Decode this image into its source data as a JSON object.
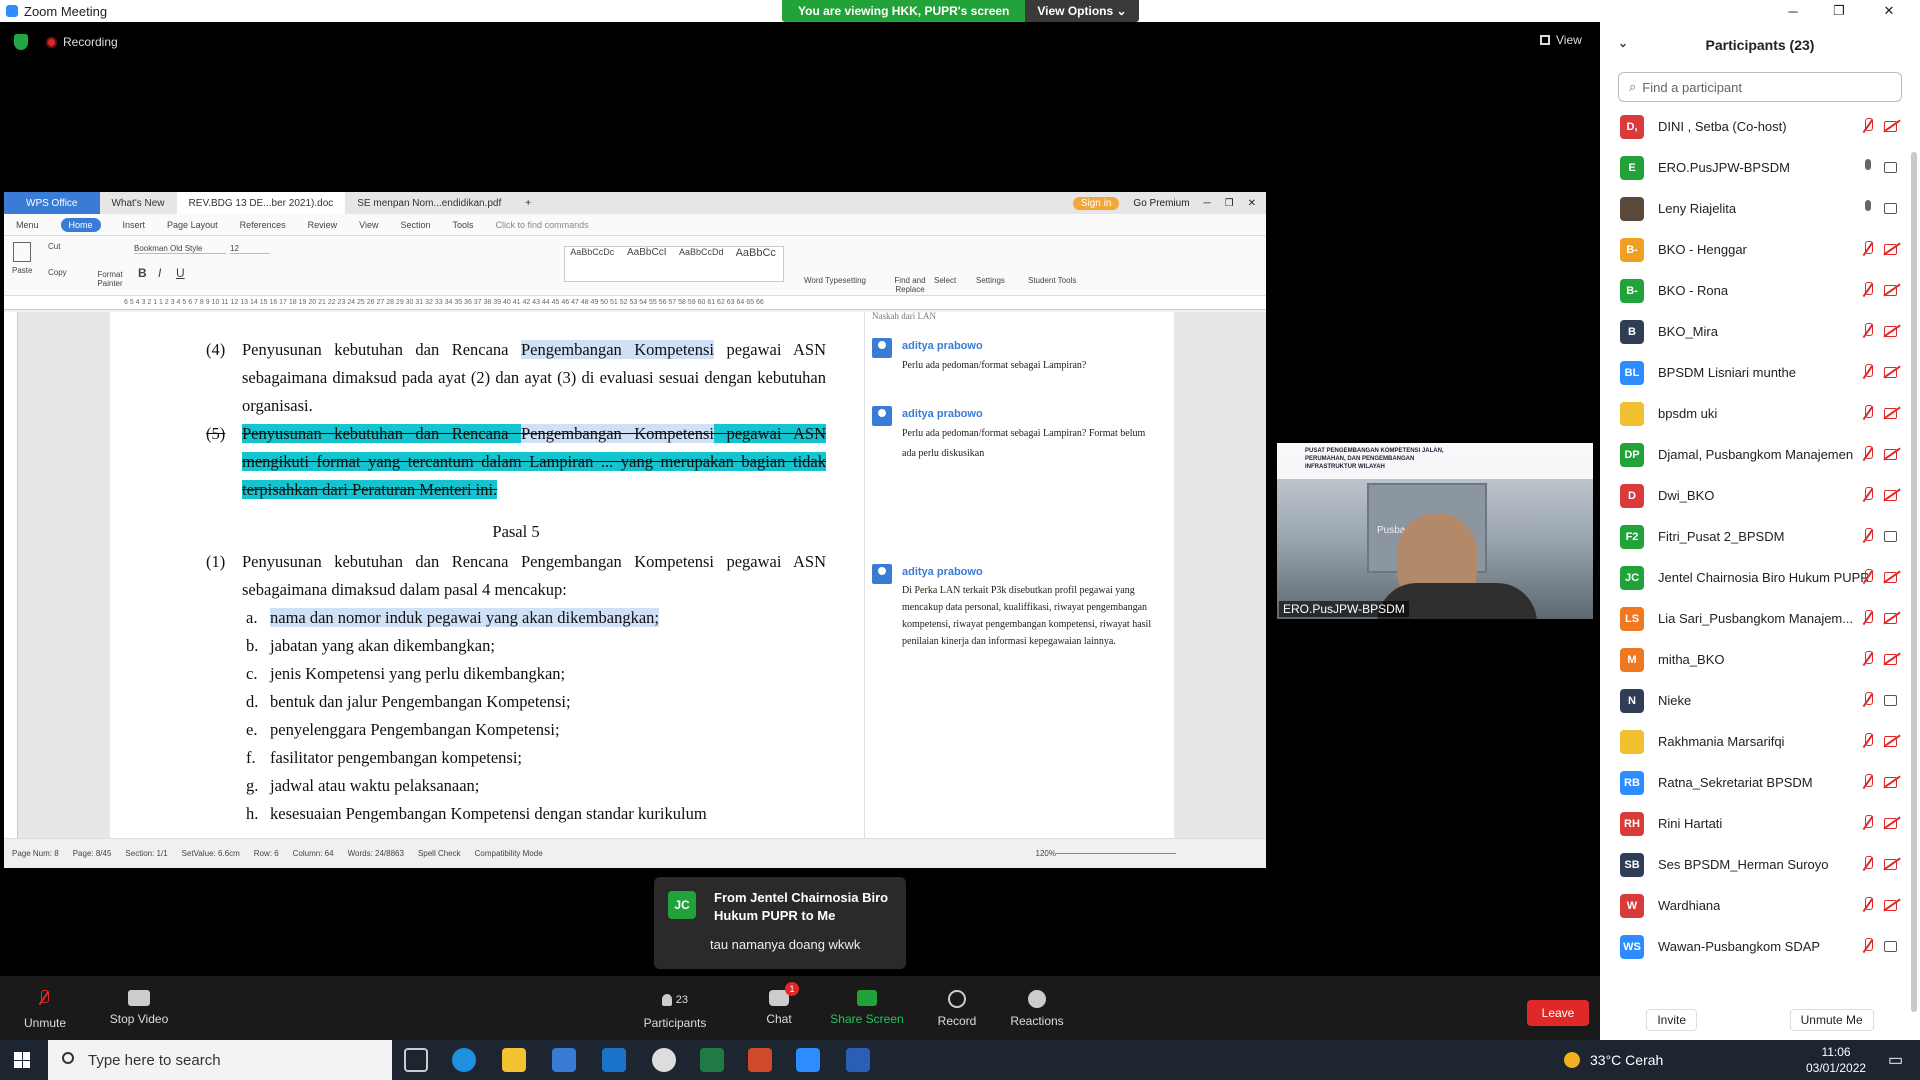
{
  "window": {
    "title": "Zoom Meeting",
    "minimize": "─",
    "maximize": "❐",
    "close": "✕"
  },
  "share_banner": {
    "viewing": "You are viewing HKK, PUPR's screen",
    "options": "View Options ⌄"
  },
  "meeting": {
    "recording": "Recording",
    "view": "View"
  },
  "wps": {
    "tabs": [
      "WPS Office",
      "What's New",
      "REV.BDG 13 DE...ber 2021).doc",
      "SE menpan Nom...endidikan.pdf"
    ],
    "signin": "Sign in",
    "premium": "Go Premium",
    "menu": [
      "Menu",
      "Home",
      "Insert",
      "Page Layout",
      "References",
      "Review",
      "View",
      "Section",
      "Tools"
    ],
    "find_commands": "Click to find commands",
    "ribbon": {
      "paste": "Paste",
      "cut": "Cut",
      "copy": "Copy",
      "format_painter": "Format Painter",
      "font": "Bookman Old Style",
      "size": "12",
      "styles": [
        "AaBbCcDc",
        "AaBbCcI",
        "AaBbCcDd",
        "AaBbCc"
      ],
      "style_names": [
        "List",
        "Normal...",
        "Page ...",
        "List Pa..."
      ],
      "word_type": "Word Typesetting",
      "find": "Find and Replace",
      "select": "Select",
      "settings": "Settings",
      "student": "Student Tools"
    },
    "ruler": "6 5 4 3 2 1 1 2 3 4 5 6 7 8 9 10 11 12 13 14 15 16 17 18 19 20 21 22 23 24 25 26 27 28 29 30 31 32 33 34 35 36 37 38 39 40 41 42 43 44 45 46 47 48 49 50 51 52 53 54 55 56 57 58 59 60 61 62 63 64 65 66",
    "doc": {
      "p4_num": "(4)",
      "p4_a": "Penyusunan kebutuhan dan Rencana",
      "p4_hl": "Pengembangan Kompetensi",
      "p4_b": "pegawai ASN sebagaimana dimaksud pada ayat (2) dan ayat (3) di evaluasi sesuai dengan kebutuhan organisasi.",
      "p5_num": "(5)",
      "p5_a": "Penyusunan kebutuhan dan Rencana",
      "p5_hl": "Pengembangan Kompetensi",
      "p5_b": "pegawai ASN mengikuti format yang tercantum dalam Lampiran ... yang merupakan bagian tidak terpisahkan dari Peraturan Menteri ini.",
      "pasal": "Pasal 5",
      "p1_num": "(1)",
      "p1_text": "Penyusunan kebutuhan dan Rencana Pengembangan Kompetensi pegawai ASN sebagaimana dimaksud dalam pasal 4 mencakup:",
      "items": [
        {
          "l": "a.",
          "t": "nama dan nomor induk pegawai yang akan dikembangkan;"
        },
        {
          "l": "b.",
          "t": "jabatan yang akan dikembangkan;"
        },
        {
          "l": "c.",
          "t": "jenis Kompetensi yang perlu dikembangkan;"
        },
        {
          "l": "d.",
          "t": "bentuk dan jalur Pengembangan Kompetensi;"
        },
        {
          "l": "e.",
          "t": "penyelenggara Pengembangan Kompetensi;"
        },
        {
          "l": "f.",
          "t": "fasilitator pengembangan kompetensi;"
        },
        {
          "l": "g.",
          "t": "jadwal atau waktu pelaksanaan;"
        },
        {
          "l": "h.",
          "t": "kesesuaian Pengembangan Kompetensi dengan standar kurikulum"
        }
      ]
    },
    "comments": [
      {
        "who": "aditya prabowo",
        "text": "Perlu ada pedoman/format sebagai Lampiran?"
      },
      {
        "who": "aditya prabowo",
        "text": "Perlu ada pedoman/format sebagai Lampiran? Format belum ada perlu diskusikan"
      },
      {
        "who": "aditya prabowo",
        "text": "Di Perka LAN terkait P3k disebutkan profil pegawai yang mencakup data personal, kualiffikasi, riwayat pengembangan kompetensi, riwayat pengembangan kompetensi, riwayat hasil penilaian kinerja dan informasi kepegawaian lainnya."
      }
    ],
    "comment_top_fragment": "Naskah dari LAN",
    "status": [
      "Page Num: 8",
      "Page: 8/45",
      "Section: 1/1",
      "SetValue: 6.6cm",
      "Row: 6",
      "Column: 64",
      "Words: 24/8863",
      "Spell Check",
      "Compatibility Mode"
    ],
    "zoom": "120%"
  },
  "video": {
    "name": "ERO.PusJPW-BPSDM",
    "banner": "PUSAT PENGEMBANGAN KOMPETENSI JALAN, PERUMAHAN, DAN PENGEMBANGAN INFRASTRUKTUR WILAYAH",
    "building": "Pusbangkom JPW"
  },
  "chat_popup": {
    "initials": "JC",
    "from": "From Jentel Chairnosia Biro Hukum PUPR to Me",
    "message": "tau namanya doang wkwk"
  },
  "toolbar": {
    "unmute": "Unmute",
    "stop_video": "Stop Video",
    "participants": "Participants",
    "participants_count": "23",
    "chat": "Chat",
    "chat_badge": "1",
    "share": "Share Screen",
    "record": "Record",
    "reactions": "Reactions",
    "leave": "Leave"
  },
  "panel": {
    "title": "Participants (23)",
    "search_placeholder": "Find a participant",
    "invite": "Invite",
    "unmute_me": "Unmute Me",
    "participants": [
      {
        "init": "D,",
        "color": "#d93a3a",
        "name": "DINI , Setba (Co-host)",
        "mic": "off",
        "cam": "off"
      },
      {
        "init": "E",
        "color": "#21a33a",
        "name": "ERO.PusJPW-BPSDM",
        "mic": "on",
        "cam": "on"
      },
      {
        "init": "",
        "color": "#5a4a3a",
        "name": "Leny Riajelita",
        "mic": "on",
        "cam": "on"
      },
      {
        "init": "B-",
        "color": "#f0a020",
        "name": "BKO - Henggar",
        "mic": "off",
        "cam": "off"
      },
      {
        "init": "B-",
        "color": "#21a33a",
        "name": "BKO - Rona",
        "mic": "off",
        "cam": "off"
      },
      {
        "init": "B",
        "color": "#2f3d55",
        "name": "BKO_Mira",
        "mic": "off",
        "cam": "off"
      },
      {
        "init": "BL",
        "color": "#2d8cff",
        "name": "BPSDM Lisniari munthe",
        "mic": "off",
        "cam": "off"
      },
      {
        "init": "",
        "color": "#f0c030",
        "name": "bpsdm uki",
        "mic": "off",
        "cam": "off"
      },
      {
        "init": "DP",
        "color": "#21a33a",
        "name": "Djamal, Pusbangkom Manajemen",
        "mic": "off",
        "cam": "off"
      },
      {
        "init": "D",
        "color": "#d93a3a",
        "name": "Dwi_BKO",
        "mic": "off",
        "cam": "off"
      },
      {
        "init": "F2",
        "color": "#21a33a",
        "name": "Fitri_Pusat 2_BPSDM",
        "mic": "off",
        "cam": "on"
      },
      {
        "init": "JC",
        "color": "#21a33a",
        "name": "Jentel Chairnosia Biro Hukum PUPR",
        "mic": "off",
        "cam": "off"
      },
      {
        "init": "LS",
        "color": "#f07820",
        "name": "Lia Sari_Pusbangkom Manajem...",
        "mic": "off",
        "cam": "off"
      },
      {
        "init": "M",
        "color": "#f07820",
        "name": "mitha_BKO",
        "mic": "off",
        "cam": "off"
      },
      {
        "init": "N",
        "color": "#2f3d55",
        "name": "Nieke",
        "mic": "off",
        "cam": "on"
      },
      {
        "init": "",
        "color": "#f0c030",
        "name": "Rakhmania Marsarifqi",
        "mic": "off",
        "cam": "off"
      },
      {
        "init": "RB",
        "color": "#2d8cff",
        "name": "Ratna_Sekretariat BPSDM",
        "mic": "off",
        "cam": "off"
      },
      {
        "init": "RH",
        "color": "#d93a3a",
        "name": "Rini Hartati",
        "mic": "off",
        "cam": "off"
      },
      {
        "init": "SB",
        "color": "#2f3d55",
        "name": "Ses BPSDM_Herman Suroyo",
        "mic": "off",
        "cam": "off"
      },
      {
        "init": "W",
        "color": "#d93a3a",
        "name": "Wardhiana",
        "mic": "off",
        "cam": "off"
      },
      {
        "init": "WS",
        "color": "#2d8cff",
        "name": "Wawan-Pusbangkom SDAP",
        "mic": "off",
        "cam": "on"
      }
    ]
  },
  "taskbar": {
    "search": "Type here to search",
    "weather": "33°C Cerah",
    "time": "11:06",
    "date": "03/01/2022"
  }
}
